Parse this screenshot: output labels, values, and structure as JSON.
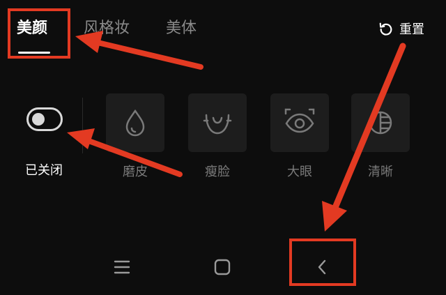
{
  "tabs": [
    {
      "label": "美颜",
      "active": true
    },
    {
      "label": "风格妆",
      "active": false
    },
    {
      "label": "美体",
      "active": false
    }
  ],
  "reset": {
    "label": "重置",
    "icon": "reset-icon"
  },
  "toggle": {
    "label": "已关闭",
    "state": "off"
  },
  "features": [
    {
      "label": "磨皮",
      "icon": "drop-icon"
    },
    {
      "label": "瘦脸",
      "icon": "slim-face-icon"
    },
    {
      "label": "大眼",
      "icon": "eye-icon"
    },
    {
      "label": "清晰",
      "icon": "clarity-icon"
    }
  ],
  "navbar": [
    {
      "icon": "menu-icon"
    },
    {
      "icon": "home-icon"
    },
    {
      "icon": "back-icon"
    }
  ],
  "colors": {
    "background": "#0d0d0d",
    "annotation": "#e33a22",
    "active_text": "#ffffff",
    "inactive_text": "#8a8a8a"
  }
}
